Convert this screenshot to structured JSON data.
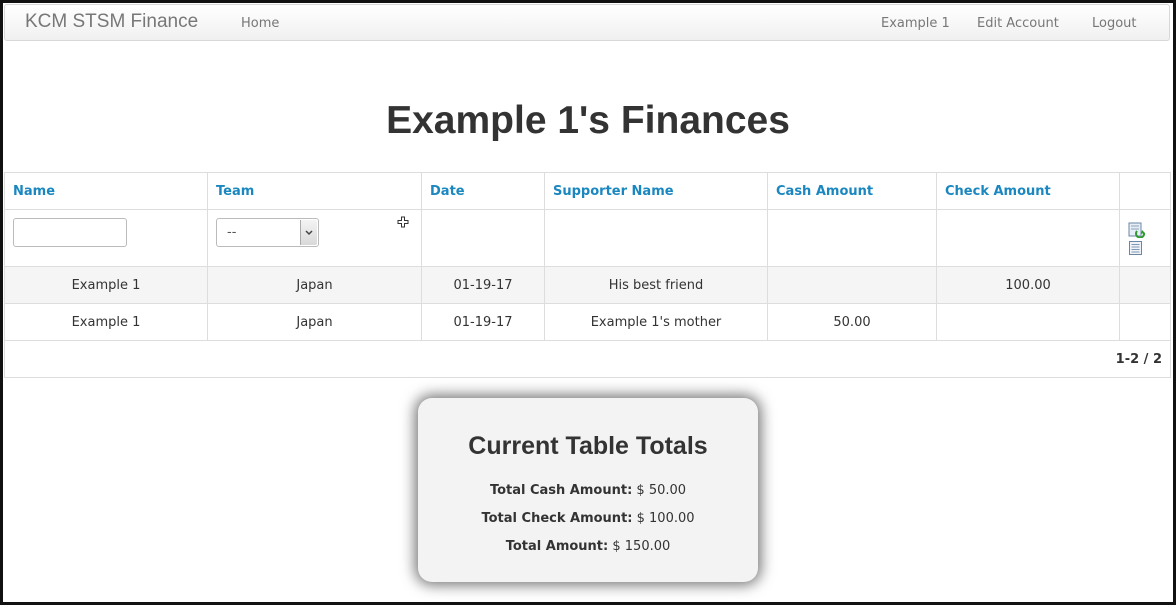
{
  "navbar": {
    "brand": "KCM STSM Finance",
    "home_label": "Home",
    "user_label": "Example 1",
    "edit_account_label": "Edit Account",
    "logout_label": "Logout"
  },
  "page": {
    "title": "Example 1's Finances"
  },
  "table": {
    "columns": [
      "Name",
      "Team",
      "Date",
      "Supporter Name",
      "Cash Amount",
      "Check Amount"
    ],
    "filters": {
      "name_value": "",
      "team_selected": "--"
    },
    "rows": [
      {
        "name": "Example 1",
        "team": "Japan",
        "date": "01-19-17",
        "supporter": "His best friend",
        "cash": "",
        "check": "100.00"
      },
      {
        "name": "Example 1",
        "team": "Japan",
        "date": "01-19-17",
        "supporter": "Example 1's mother",
        "cash": "50.00",
        "check": ""
      }
    ],
    "pagination": "1-2 / 2"
  },
  "totals": {
    "title": "Current Table Totals",
    "cash_label": "Total Cash Amount:",
    "cash_value": "$ 50.00",
    "check_label": "Total Check Amount:",
    "check_value": "$ 100.00",
    "total_label": "Total Amount:",
    "total_value": "$ 150.00"
  },
  "icons": {
    "refresh": "refresh-icon",
    "report": "report-icon",
    "move": "move-icon"
  }
}
